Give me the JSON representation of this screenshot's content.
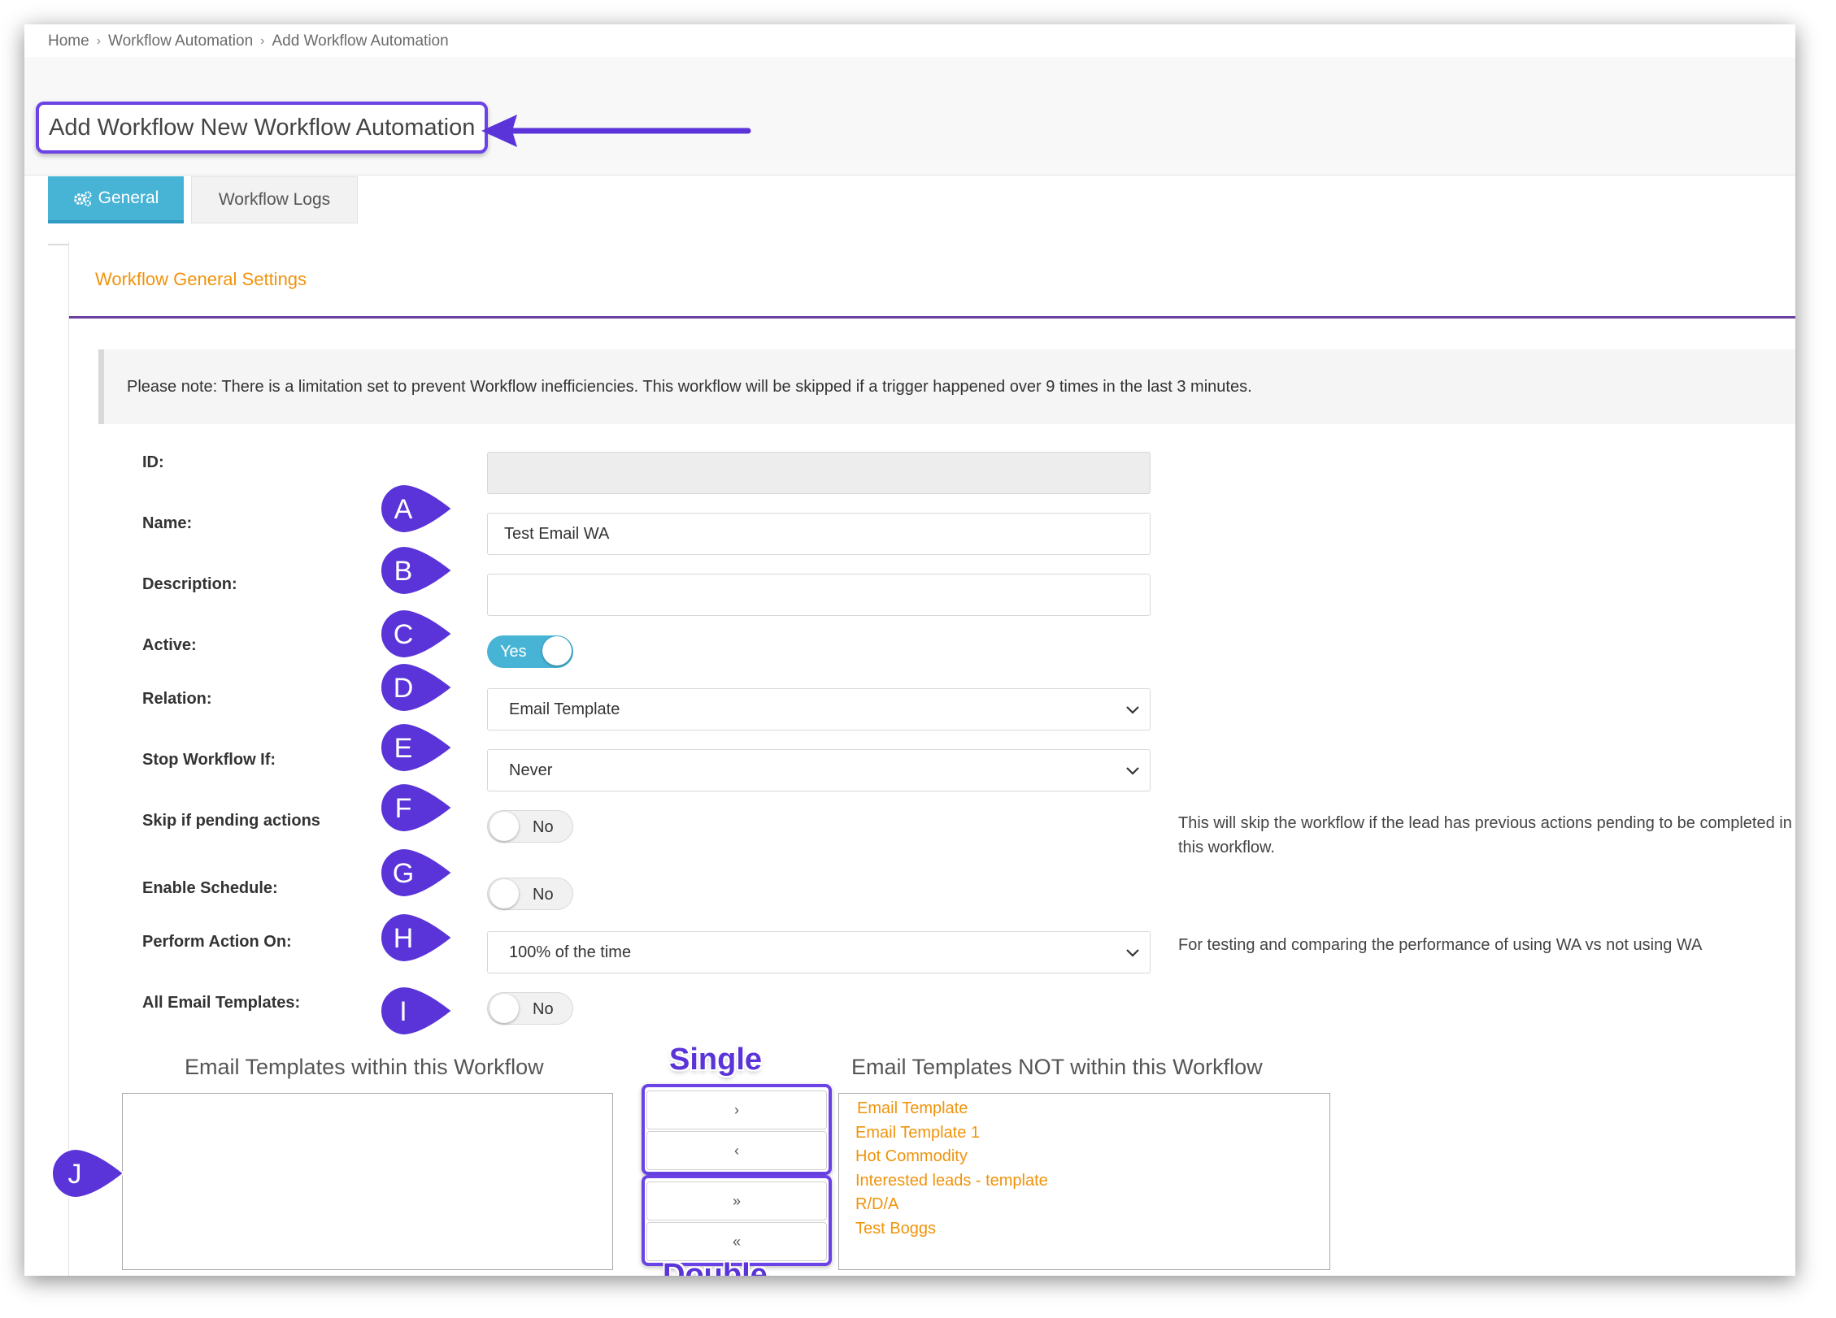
{
  "breadcrumb": {
    "home": "Home",
    "section": "Workflow Automation",
    "current": "Add Workflow Automation"
  },
  "page": {
    "title": "Add Workflow New Workflow Automation"
  },
  "tabs": [
    {
      "label": "General",
      "icon": "gears-icon"
    },
    {
      "label": "Workflow Logs"
    }
  ],
  "panel": {
    "title": "Workflow General Settings"
  },
  "note": "Please note: There is a limitation set to prevent Workflow inefficiencies. This workflow will be skipped if a trigger happened over 9 times in the last 3 minutes.",
  "form": {
    "id": {
      "label": "ID:",
      "value": ""
    },
    "name": {
      "label": "Name:",
      "value": "Test Email WA"
    },
    "description": {
      "label": "Description:",
      "value": ""
    },
    "active": {
      "label": "Active:",
      "value": "Yes"
    },
    "relation": {
      "label": "Relation:",
      "value": "Email Template"
    },
    "stop_workflow_if": {
      "label": "Stop Workflow If:",
      "value": "Never"
    },
    "skip_pending": {
      "label": "Skip if pending actions",
      "value": "No",
      "help": "This will skip the workflow if the lead has previous actions pending to be completed in this workflow."
    },
    "enable_schedule": {
      "label": "Enable Schedule:",
      "value": "No"
    },
    "perform_action_on": {
      "label": "Perform Action On:",
      "value": "100% of the time",
      "help": "For testing and comparing the performance of using WA vs not using WA"
    },
    "all_email_templates": {
      "label": "All Email Templates:",
      "value": "No"
    }
  },
  "lists": {
    "within_title": "Email Templates within this Workflow",
    "not_within_title": "Email Templates NOT within this Workflow",
    "within_items": [],
    "not_within_items": [
      "Email Template",
      "Email Template 1",
      "Hot Commodity",
      "Interested leads - template",
      "R/D/A",
      "Test Boggs"
    ],
    "buttons": {
      "move_one_right": "›",
      "move_one_left": "‹",
      "move_all_right": "»",
      "move_all_left": "«"
    }
  },
  "annotations": {
    "markers": [
      "A",
      "B",
      "C",
      "D",
      "E",
      "F",
      "G",
      "H",
      "I",
      "J"
    ],
    "single": "Single",
    "double": "Double"
  },
  "colors": {
    "accent": "#47b4d6",
    "orange": "#f0930b",
    "annotation": "#5a34d8",
    "panel_rule": "#6a3fa0"
  }
}
